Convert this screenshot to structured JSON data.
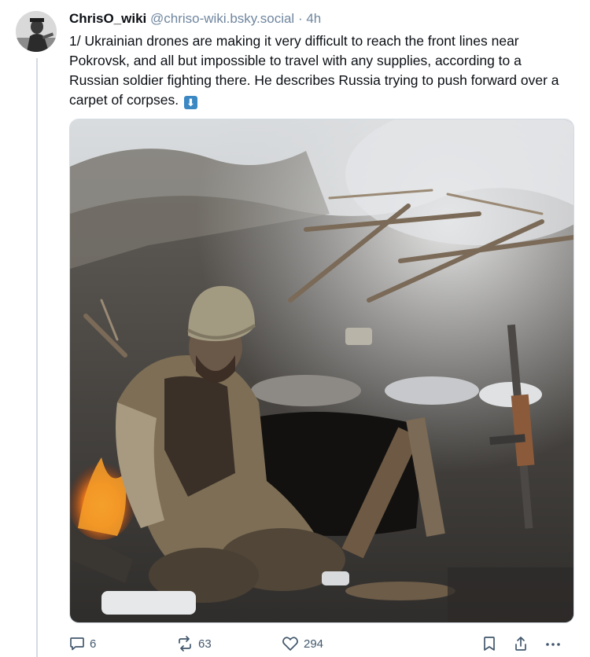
{
  "post": {
    "author": {
      "display_name": "ChrisO_wiki",
      "handle": "@chriso-wiki.bsky.social",
      "avatar_icon": "user-avatar"
    },
    "separator": "·",
    "timestamp": "4h",
    "text": "1/ Ukrainian drones are making it very difficult to reach the front lines near Pokrovsk, and all but impossible to travel with any supplies, according to a Russian soldier fighting there. He describes Russia trying to push forward over a carpet of corpses.",
    "text_emoji": "⬇",
    "media": {
      "type": "image"
    }
  },
  "actions": {
    "reply": {
      "icon": "reply-icon",
      "count": "6"
    },
    "repost": {
      "icon": "repost-icon",
      "count": "63"
    },
    "like": {
      "icon": "heart-icon",
      "count": "294"
    },
    "bookmark": {
      "icon": "bookmark-icon"
    },
    "share": {
      "icon": "share-icon"
    },
    "more": {
      "icon": "more-icon"
    }
  },
  "colors": {
    "text": "#0b0f14",
    "muted": "#6f869f",
    "action": "#42576c",
    "border": "#d4dbe2",
    "emoji_blue": "#3b88c3"
  }
}
